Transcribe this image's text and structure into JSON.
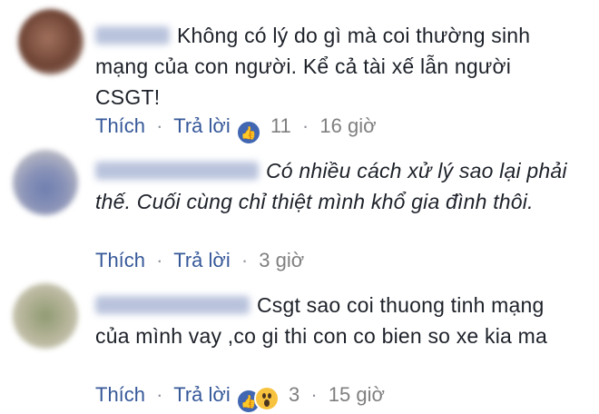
{
  "comments": [
    {
      "text": "Không có lý do gì mà coi thường sinh mạng của con người. Kể cả tài xế lẫn người CSGT!",
      "like_label": "Thích",
      "reply_label": "Trả lời",
      "reaction_count": "11",
      "time": "16 giờ",
      "reactions": [
        "like-icon"
      ]
    },
    {
      "text": "Có nhiều cách xử lý sao lại phải thế. Cuối cùng chỉ thiệt mình khổ gia đình thôi.",
      "like_label": "Thích",
      "reply_label": "Trả lời",
      "time": "3 giờ",
      "reactions": []
    },
    {
      "text": "Csgt sao coi thuong tinh mạng của mình vay ,co gi thi con co bien so xe kia ma",
      "like_label": "Thích",
      "reply_label": "Trả lời",
      "reaction_count": "3",
      "time": "15 giờ",
      "reactions": [
        "like-icon",
        "wow-icon"
      ]
    }
  ],
  "colors": {
    "link": "#365899",
    "meta": "#7f7f7f",
    "text": "#1d2129",
    "like": "#4267b2",
    "wow": "#f7c33f"
  }
}
